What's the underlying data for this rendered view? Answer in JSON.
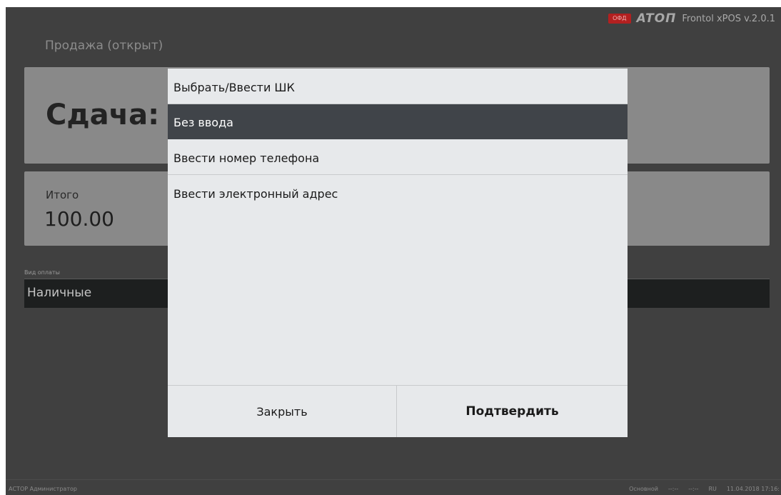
{
  "header": {
    "ofd_badge": "ОФД",
    "logo_text": "ATOΠ",
    "app_version": "Frontol xPOS v.2.0.1",
    "document_state": "Продажа (открыт)"
  },
  "change_panel": {
    "label": "Сдача:"
  },
  "total_panel": {
    "label": "Итого",
    "value": "100.00"
  },
  "payment": {
    "type_label": "Вид оплаты",
    "type_value": "Наличные"
  },
  "modal": {
    "title": "Выбрать/Ввести ШК",
    "options": [
      {
        "label": "Без ввода",
        "selected": true
      },
      {
        "label": "Ввести номер телефона",
        "selected": false
      },
      {
        "label": "Ввести электронный адрес",
        "selected": false
      }
    ],
    "close_label": "Закрыть",
    "confirm_label": "Подтвердить"
  },
  "statusbar": {
    "user_left": "АСТОР  Администратор",
    "mode": "Основной",
    "indicator_1": "--:--",
    "indicator_2": "--:--",
    "lang": "RU",
    "datetime": "11.04.2018 17:16:"
  },
  "colors": {
    "background": "#404040",
    "panel": "#898989",
    "selected_row": "#404449",
    "modal_bg": "#e7e9eb",
    "ofd_badge": "#b32020"
  }
}
